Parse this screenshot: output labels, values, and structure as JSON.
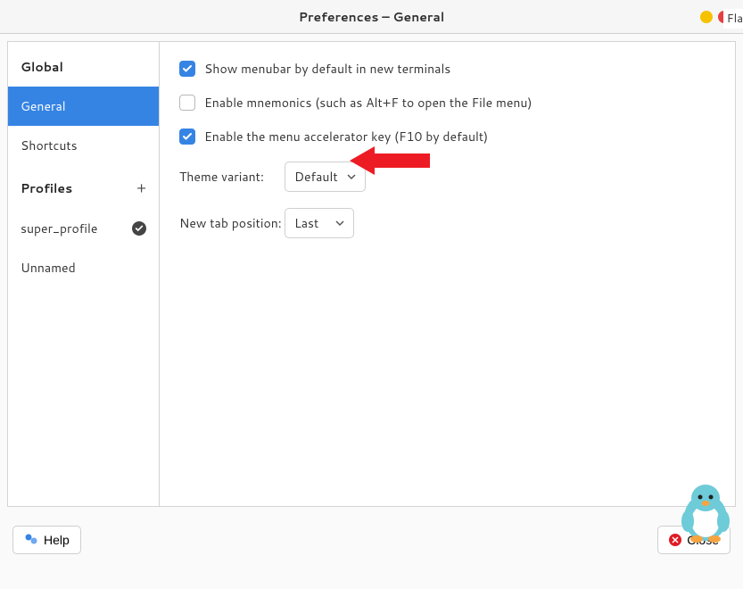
{
  "window": {
    "title": "Preferences – General",
    "corner_badge": "Fla"
  },
  "sidebar": {
    "global_heading": "Global",
    "profiles_heading": "Profiles",
    "items": [
      {
        "label": "General",
        "active": true
      },
      {
        "label": "Shortcuts",
        "active": false
      }
    ],
    "profiles": [
      {
        "label": "super_profile",
        "default": true
      },
      {
        "label": "Unnamed",
        "default": false
      }
    ]
  },
  "settings": {
    "show_menubar": {
      "label": "Show menubar by default in new terminals",
      "checked": true
    },
    "mnemonics": {
      "label": "Enable mnemonics (such as Alt+F to open the File menu)",
      "checked": false
    },
    "accelerator": {
      "label": "Enable the menu accelerator key (F10 by default)",
      "checked": true
    },
    "theme_variant": {
      "label": "Theme variant:",
      "value": "Default"
    },
    "new_tab_position": {
      "label": "New tab position:",
      "value": "Last"
    }
  },
  "footer": {
    "help_label": "Help",
    "close_label": "Close"
  }
}
